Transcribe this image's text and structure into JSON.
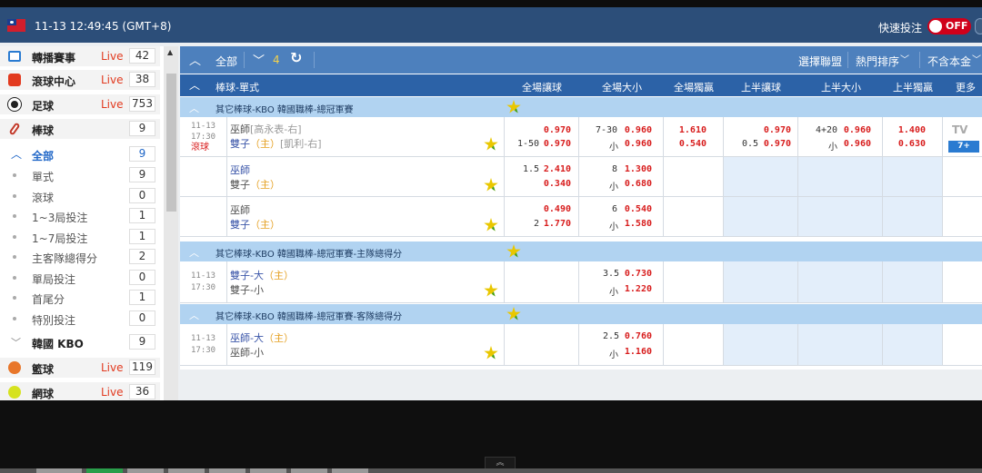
{
  "header": {
    "time": "11-13 12:49:45 (GMT+8)",
    "quick_bet_label": "快速投注",
    "quick_bet_state": "OFF"
  },
  "sidebar": {
    "sports": [
      {
        "label": "轉播賽事",
        "live": "Live",
        "count": "42",
        "icon": "tv-icon"
      },
      {
        "label": "滾球中心",
        "live": "Live",
        "count": "38",
        "icon": "running-icon"
      },
      {
        "label": "足球",
        "live": "Live",
        "count": "753",
        "icon": "soccer-ball-icon"
      },
      {
        "label": "棒球",
        "live": "",
        "count": "9",
        "icon": "baseball-bat-icon"
      }
    ],
    "baseball_items": [
      {
        "label": "全部",
        "count": "9"
      },
      {
        "label": "單式",
        "count": "9"
      },
      {
        "label": "滾球",
        "count": "0"
      },
      {
        "label": "1~3局投注",
        "count": "1"
      },
      {
        "label": "1~7局投注",
        "count": "1"
      },
      {
        "label": "主客隊總得分",
        "count": "2"
      },
      {
        "label": "單局投注",
        "count": "0"
      },
      {
        "label": "首尾分",
        "count": "1"
      },
      {
        "label": "特別投注",
        "count": "0"
      }
    ],
    "kbo": {
      "label": "韓國 KBO",
      "count": "9"
    },
    "more_sports": [
      {
        "label": "籃球",
        "live": "Live",
        "count": "119",
        "icon": "basketball-icon"
      },
      {
        "label": "網球",
        "live": "Live",
        "count": "36",
        "icon": "tennis-ball-icon"
      }
    ]
  },
  "toolbar": {
    "all_label": "全部",
    "count": "4",
    "select_league": "選擇聯盟",
    "sort": "熱門排序",
    "principal": "不含本金"
  },
  "columns": {
    "sport_type": "棒球-單式",
    "ft_hdp": "全場讓球",
    "ft_ou": "全場大小",
    "ft_1x2": "全場獨贏",
    "h1_hdp": "上半讓球",
    "h1_ou": "上半大小",
    "h1_1x2": "上半獨贏",
    "more": "更多"
  },
  "leagues": [
    {
      "name": "其它棒球-KBO 韓國職棒-總冠軍賽"
    },
    {
      "name": "其它棒球-KBO 韓國職棒-總冠軍賽-主隊總得分"
    },
    {
      "name": "其它棒球-KBO 韓國職棒-總冠軍賽-客隊總得分"
    }
  ],
  "match1": {
    "date": "11-13",
    "time": "17:30",
    "status": "滾球",
    "team1": "巫師",
    "pitcher1": "[高永表-右]",
    "team2": "雙子",
    "home": "（主）",
    "pitcher2": "[凱利-右]",
    "rows": [
      {
        "hdp_line": "",
        "hdp_odds1": "0.970",
        "hdp_line2": "1-50",
        "hdp_odds2": "0.970",
        "ou_line": "7-30",
        "ou_odds1": "0.960",
        "ou_under": "小",
        "ou_odds2": "0.960",
        "x1": "1.610",
        "x2": "0.540",
        "h1_hdp1": "0.970",
        "h1_line2": "0.5",
        "h1_hdp2": "0.970",
        "h1_ou_line": "4+20",
        "h1_ou1": "0.960",
        "h1_under": "小",
        "h1_ou2": "0.960",
        "h1_x1": "1.400",
        "h1_x2": "0.630"
      },
      {
        "hdp_line": "1.5",
        "hdp_odds1": "2.410",
        "hdp_odds2": "0.340",
        "ou_line": "8",
        "ou_odds1": "1.300",
        "ou_under": "小",
        "ou_odds2": "0.680"
      },
      {
        "hdp_odds1": "0.490",
        "hdp_line2": "2",
        "hdp_odds2": "1.770",
        "ou_line": "6",
        "ou_odds1": "0.540",
        "ou_under": "小",
        "ou_odds2": "1.580"
      }
    ],
    "tv": "TV",
    "more_count": "7+"
  },
  "match2": {
    "date": "11-13",
    "time": "17:30",
    "team1": "雙子-大",
    "home": "（主）",
    "team2": "雙子-小",
    "ou_line": "3.5",
    "ou_odds1": "0.730",
    "ou_under": "小",
    "ou_odds2": "1.220"
  },
  "match3": {
    "date": "11-13",
    "time": "17:30",
    "team1": "巫師-大",
    "home": "（主）",
    "team2": "巫師-小",
    "ou_line": "2.5",
    "ou_odds1": "0.760",
    "ou_under": "小",
    "ou_odds2": "1.160"
  },
  "colors": {
    "live": "#e23a1f",
    "odds": "#d81e1e",
    "header": "#2c62a7",
    "toolbar": "#4d80bd",
    "league": "#b1d3f1",
    "accent_blue": "#e3eefa"
  }
}
